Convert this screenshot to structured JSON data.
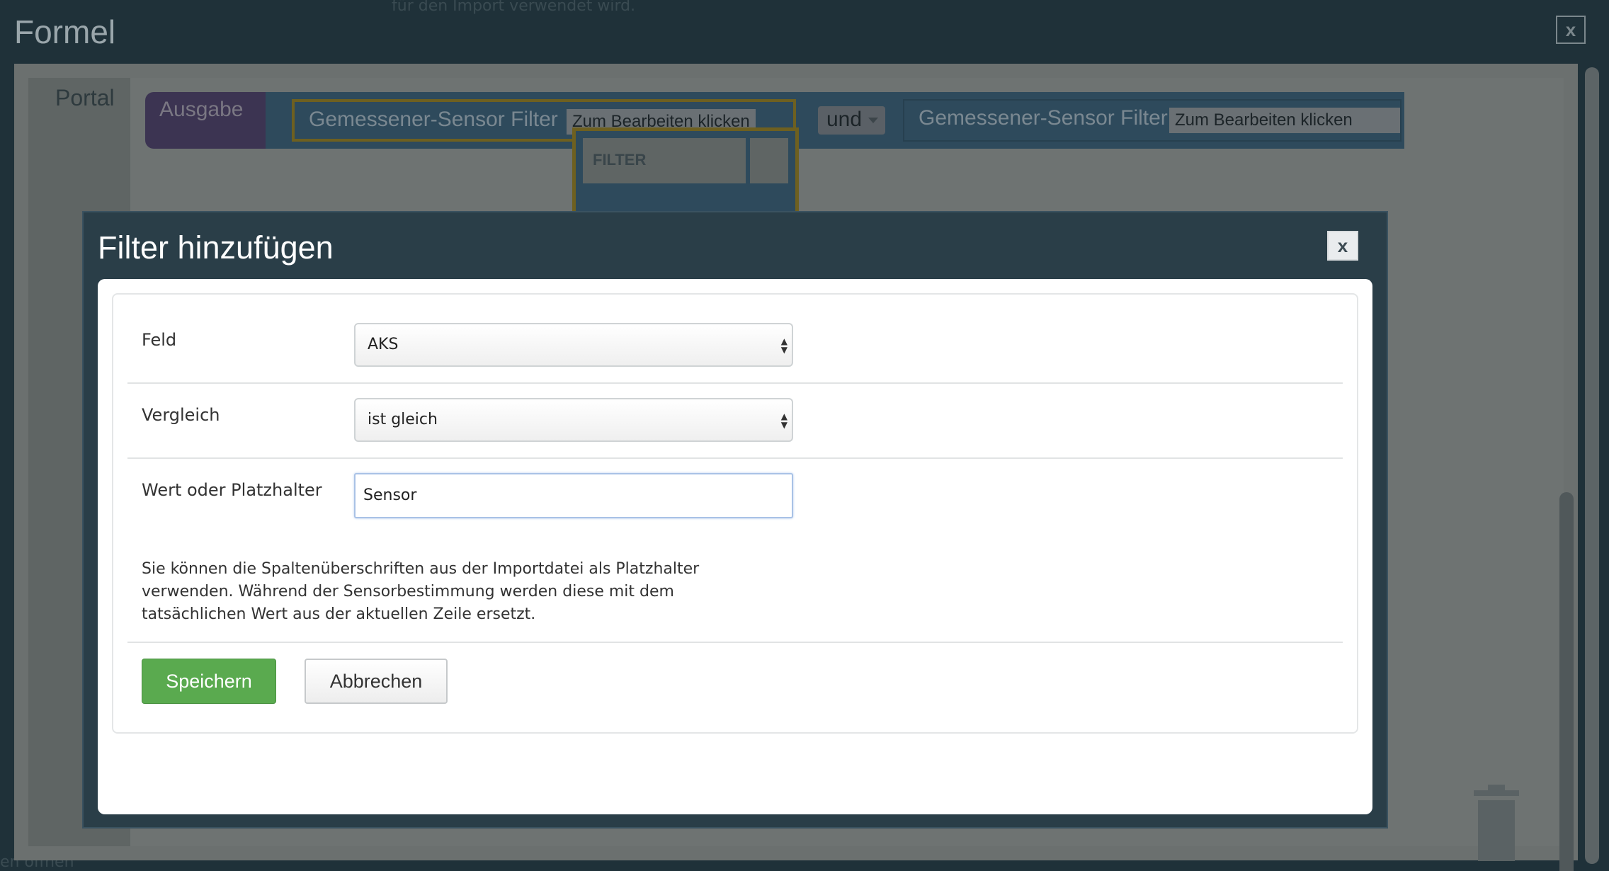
{
  "background": {
    "top_text": "für den Import verwendet wird.",
    "bottom_text": "en öffnen"
  },
  "formel": {
    "title": "Formel",
    "close_label": "x",
    "portal_label": "Portal"
  },
  "blocks": {
    "output_label": "Ausgabe",
    "sensor_filter_1": "Gemessener-Sensor Filter",
    "edit_1": "Zum Bearbeiten klicken",
    "operator": "und",
    "sensor_filter_2": "Gemessener-Sensor Filter",
    "edit_2": "Zum Bearbeiten klicken",
    "filter_header": "FILTER",
    "add_filter": "Filter hinzufügen"
  },
  "modal": {
    "title": "Filter hinzufügen",
    "close_label": "x",
    "fields": {
      "field_label": "Feld",
      "field_value": "AKS",
      "comparison_label": "Vergleich",
      "comparison_value": "ist gleich",
      "value_label": "Wert oder Platzhalter",
      "value_input": "Sensor"
    },
    "help_text": "Sie können die Spaltenüberschriften aus der Importdatei als Platzhalter verwenden. Während der Sensorbestimmung werden diese mit dem tatsächlichen Wert aus der aktuellen Zeile ersetzt.",
    "save_label": "Speichern",
    "cancel_label": "Abbrechen"
  },
  "colors": {
    "overlay": "#1f3139",
    "modal_header": "#2a3e48",
    "save_button": "#5aaa4f",
    "input_focus_border": "#a9c2e6"
  }
}
